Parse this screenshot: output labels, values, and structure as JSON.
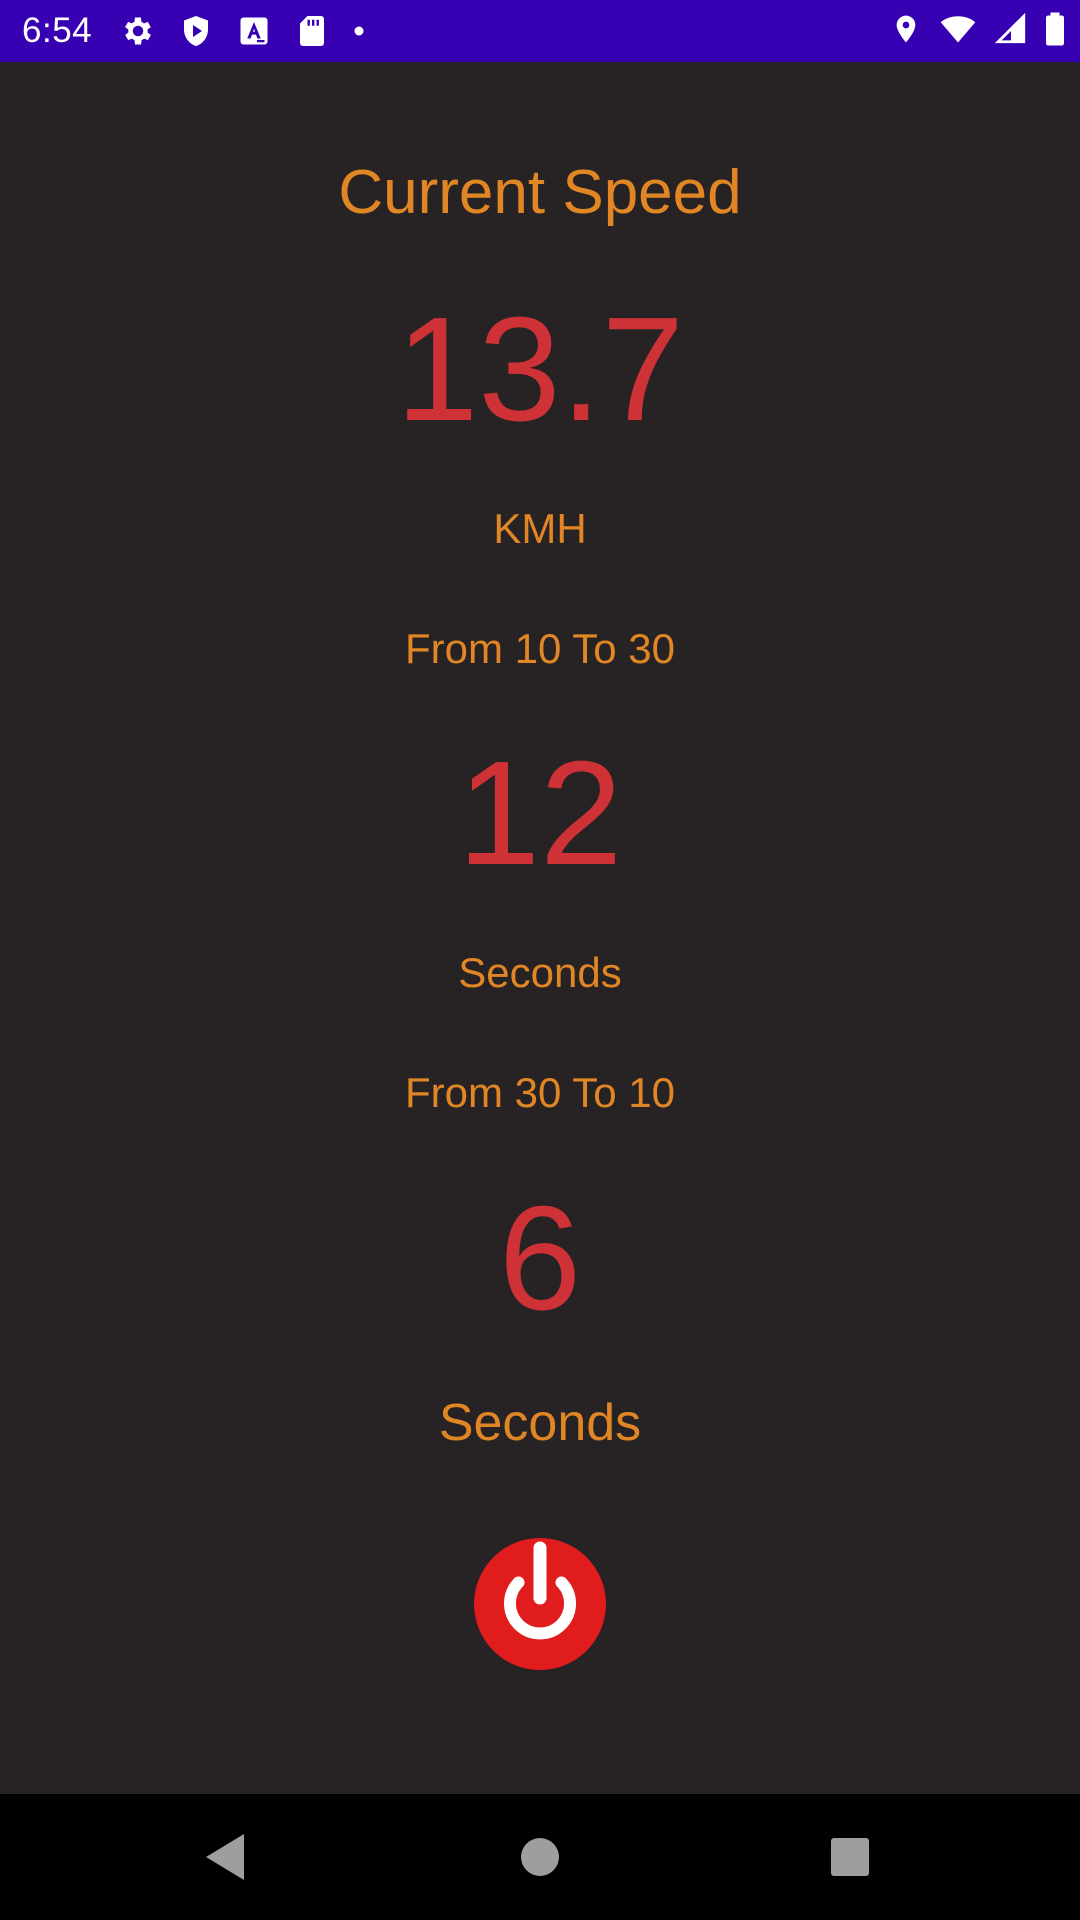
{
  "status_bar": {
    "time": "6:54",
    "background_color": "#3700b3",
    "left_icons": [
      "settings-gear-icon",
      "play-protect-icon",
      "text-a-icon",
      "sd-card-icon",
      "notification-dot-icon"
    ],
    "right_icons": [
      "location-pin-icon",
      "wifi-icon",
      "cell-signal-icon",
      "battery-icon"
    ]
  },
  "speed": {
    "title": "Current Speed",
    "value": "13.7",
    "unit": "KMH"
  },
  "acceleration": {
    "label": "From 10 To 30",
    "value": "12",
    "unit": "Seconds"
  },
  "deceleration": {
    "label": "From 30 To 10",
    "value": "6",
    "unit": "Seconds"
  },
  "power": {
    "icon": "power-icon",
    "color": "#e01c1c"
  },
  "nav_bar": {
    "icons": [
      "back-triangle-icon",
      "home-circle-icon",
      "recents-square-icon"
    ]
  },
  "colors": {
    "background": "#272223",
    "label": "#e18624",
    "value": "#cf3236"
  }
}
